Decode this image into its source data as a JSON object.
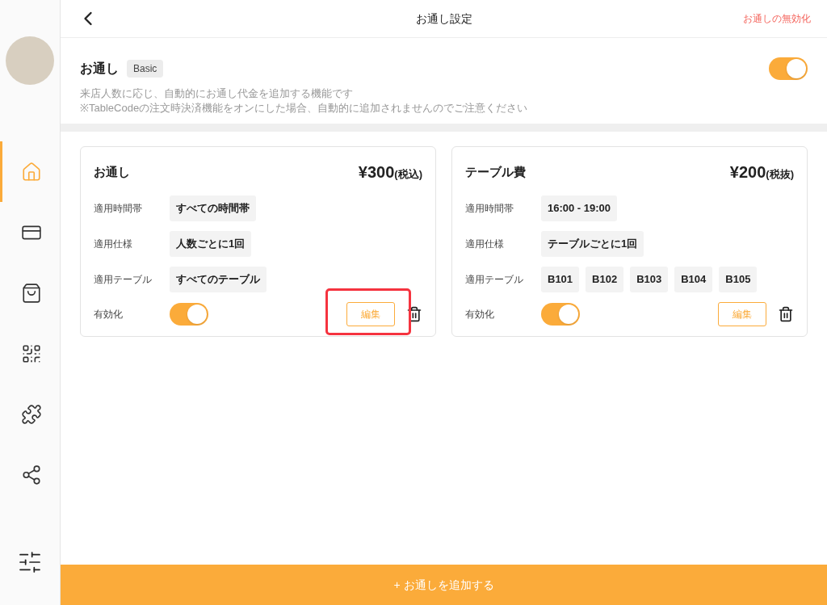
{
  "sidebar": {
    "items": [
      {
        "kind": "home",
        "selected": true
      },
      {
        "kind": "card",
        "selected": false
      },
      {
        "kind": "bag",
        "selected": false
      },
      {
        "kind": "qr",
        "selected": false
      },
      {
        "kind": "puzzle",
        "selected": false
      },
      {
        "kind": "network",
        "selected": false
      }
    ],
    "bottom": {
      "kind": "sliders"
    }
  },
  "header": {
    "title": "お通し設定",
    "action": "お通しの無効化"
  },
  "intro": {
    "title": "お通し",
    "badge": "Basic",
    "on": true,
    "lines": [
      "来店人数に応じ、自動的にお通し代金を追加する機能です",
      "※TableCodeの注文時決済機能をオンにした場合、自動的に追加されませんのでご注意ください"
    ]
  },
  "cards": [
    {
      "name": "お通し",
      "price": "¥300",
      "tax": "(税込)",
      "rows": [
        {
          "label": "適用時間帯",
          "values": [
            "すべての時間帯"
          ]
        },
        {
          "label": "適用仕様",
          "values": [
            "人数ごとに1回"
          ]
        },
        {
          "label": "適用テーブル",
          "values": [
            "すべてのテーブル"
          ]
        }
      ],
      "enabled_label": "有効化",
      "enabled": true,
      "edit": "編集",
      "highlighted": true
    },
    {
      "name": "テーブル費",
      "price": "¥200",
      "tax": "(税抜)",
      "rows": [
        {
          "label": "適用時間帯",
          "values": [
            "16:00 - 19:00"
          ]
        },
        {
          "label": "適用仕様",
          "values": [
            "テーブルごとに1回"
          ]
        },
        {
          "label": "適用テーブル",
          "values": [
            "B101",
            "B102",
            "B103",
            "B104",
            "B105"
          ]
        }
      ],
      "enabled_label": "有効化",
      "enabled": true,
      "edit": "編集",
      "highlighted": false
    }
  ],
  "add_button": "+ お通しを追加する"
}
